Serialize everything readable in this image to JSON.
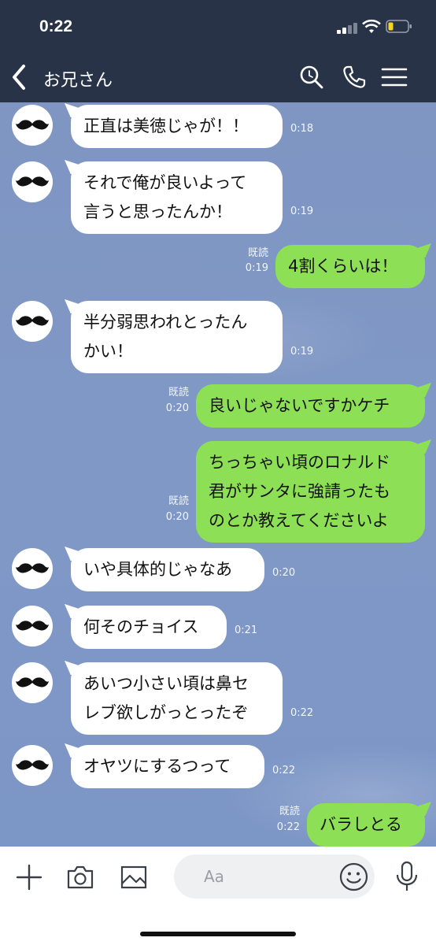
{
  "status_bar": {
    "time": "0:22"
  },
  "header": {
    "title": "お兄さん"
  },
  "messages": [
    {
      "text": "正直は美徳じゃが！！",
      "time": "0:18"
    },
    {
      "text": "それで俺が良いよって\n言うと思ったんか！",
      "time": "0:19"
    },
    {
      "text": "4割くらいは！",
      "read": "既読",
      "time": "0:19"
    },
    {
      "text": "半分弱思われとったん\nかい！",
      "time": "0:19"
    },
    {
      "text": "良いじゃないですかケチ",
      "read": "既読",
      "time": "0:20"
    },
    {
      "text": "ちっちゃい頃のロナルド\n君がサンタに強請ったも\nのとか教えてくださいよ",
      "read": "既読",
      "time": "0:20"
    },
    {
      "text": "いや具体的じゃなあ",
      "time": "0:20"
    },
    {
      "text": "何そのチョイス",
      "time": "0:21"
    },
    {
      "text": "あいつ小さい頃は鼻セ\nレブ欲しがっとったぞ",
      "time": "0:22"
    },
    {
      "text": "オヤツにするつって",
      "time": "0:22"
    },
    {
      "text": "バラしとる",
      "read": "既読",
      "time": "0:22"
    }
  ],
  "input": {
    "placeholder": "Aa"
  },
  "colors": {
    "header": "#283347",
    "outgoing_bubble": "#8de055",
    "incoming_bubble": "#ffffff",
    "chat_background": "#7f96c3"
  },
  "icons": [
    "back-icon",
    "search-icon",
    "phone-icon",
    "menu-icon",
    "plus-icon",
    "camera-icon",
    "image-icon",
    "emoji-icon",
    "mic-icon",
    "mustache-icon"
  ]
}
